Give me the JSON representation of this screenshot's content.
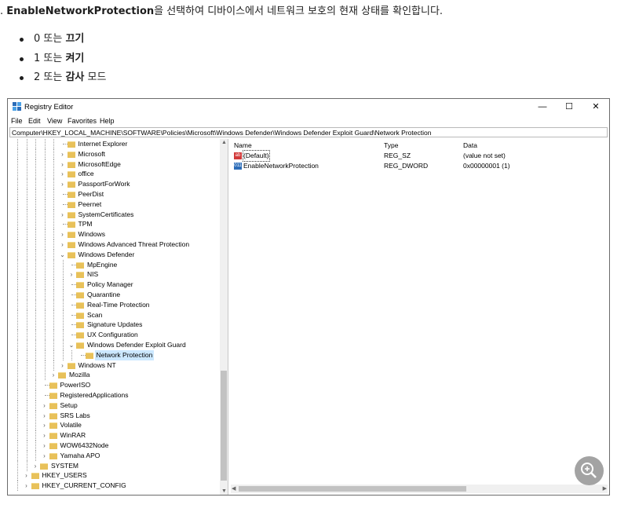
{
  "intro": {
    "prefix": ". ",
    "bold": "EnableNetworkProtection",
    "rest": "을 선택하여 디바이스에서 네트워크 보호의 현재 상태를 확인합니다."
  },
  "options": [
    {
      "prefix": "0 또는 ",
      "bold": "끄기",
      "suffix": ""
    },
    {
      "prefix": "1 또는 ",
      "bold": "켜기",
      "suffix": ""
    },
    {
      "prefix": "2 또는 ",
      "bold": "감사",
      "suffix": " 모드"
    }
  ],
  "window": {
    "title": "Registry Editor",
    "controls": {
      "minimize": "—",
      "maximize": "☐",
      "close": "✕"
    },
    "menu": [
      "File",
      "Edit",
      "View",
      "Favorites",
      "Help"
    ],
    "address": "Computer\\HKEY_LOCAL_MACHINE\\SOFTWARE\\Policies\\Microsoft\\Windows Defender\\Windows Defender Exploit Guard\\Network Protection"
  },
  "tree": [
    {
      "label": "Internet Explorer",
      "level": 6,
      "chev": ""
    },
    {
      "label": "Microsoft",
      "level": 6,
      "chev": ">"
    },
    {
      "label": "MicrosoftEdge",
      "level": 6,
      "chev": ">"
    },
    {
      "label": "office",
      "level": 6,
      "chev": ">"
    },
    {
      "label": "PassportForWork",
      "level": 6,
      "chev": ">"
    },
    {
      "label": "PeerDist",
      "level": 6,
      "chev": ""
    },
    {
      "label": "Peernet",
      "level": 6,
      "chev": ""
    },
    {
      "label": "SystemCertificates",
      "level": 6,
      "chev": ">"
    },
    {
      "label": "TPM",
      "level": 6,
      "chev": ""
    },
    {
      "label": "Windows",
      "level": 6,
      "chev": ">"
    },
    {
      "label": "Windows Advanced Threat Protection",
      "level": 6,
      "chev": ">"
    },
    {
      "label": "Windows Defender",
      "level": 6,
      "chev": "v"
    },
    {
      "label": "MpEngine",
      "level": 7,
      "chev": ""
    },
    {
      "label": "NIS",
      "level": 7,
      "chev": ">"
    },
    {
      "label": "Policy Manager",
      "level": 7,
      "chev": ""
    },
    {
      "label": "Quarantine",
      "level": 7,
      "chev": ""
    },
    {
      "label": "Real-Time Protection",
      "level": 7,
      "chev": ""
    },
    {
      "label": "Scan",
      "level": 7,
      "chev": ""
    },
    {
      "label": "Signature Updates",
      "level": 7,
      "chev": ""
    },
    {
      "label": "UX Configuration",
      "level": 7,
      "chev": ""
    },
    {
      "label": "Windows Defender Exploit Guard",
      "level": 7,
      "chev": "v"
    },
    {
      "label": "Network Protection",
      "level": 8,
      "chev": "",
      "selected": true
    },
    {
      "label": "Windows NT",
      "level": 6,
      "chev": ">"
    },
    {
      "label": "Mozilla",
      "level": 5,
      "chev": ">"
    },
    {
      "label": "PowerISO",
      "level": 4,
      "chev": ""
    },
    {
      "label": "RegisteredApplications",
      "level": 4,
      "chev": ""
    },
    {
      "label": "Setup",
      "level": 4,
      "chev": ">"
    },
    {
      "label": "SRS Labs",
      "level": 4,
      "chev": ">"
    },
    {
      "label": "Volatile",
      "level": 4,
      "chev": ">"
    },
    {
      "label": "WinRAR",
      "level": 4,
      "chev": ">"
    },
    {
      "label": "WOW6432Node",
      "level": 4,
      "chev": ">"
    },
    {
      "label": "Yamaha APO",
      "level": 4,
      "chev": ">"
    },
    {
      "label": "SYSTEM",
      "level": 3,
      "chev": ">"
    },
    {
      "label": "HKEY_USERS",
      "level": 2,
      "chev": ">"
    },
    {
      "label": "HKEY_CURRENT_CONFIG",
      "level": 2,
      "chev": ">"
    }
  ],
  "values": {
    "headers": {
      "name": "Name",
      "type": "Type",
      "data": "Data"
    },
    "rows": [
      {
        "icon": "string-value-icon",
        "icon_text": "ab",
        "name": "(Default)",
        "type": "REG_SZ",
        "data": "(value not set)"
      },
      {
        "icon": "binary-value-icon",
        "icon_text": "011",
        "name": "EnableNetworkProtection",
        "type": "REG_DWORD",
        "data": "0x00000001 (1)"
      }
    ]
  },
  "icons": {
    "app": "registry-icon",
    "zoom": "zoom-in-icon"
  },
  "colors": {
    "folder": "#e8c15a",
    "selection": "#cce8ff",
    "string_icon": "#d23a3a",
    "binary_icon": "#2b6cb8"
  }
}
